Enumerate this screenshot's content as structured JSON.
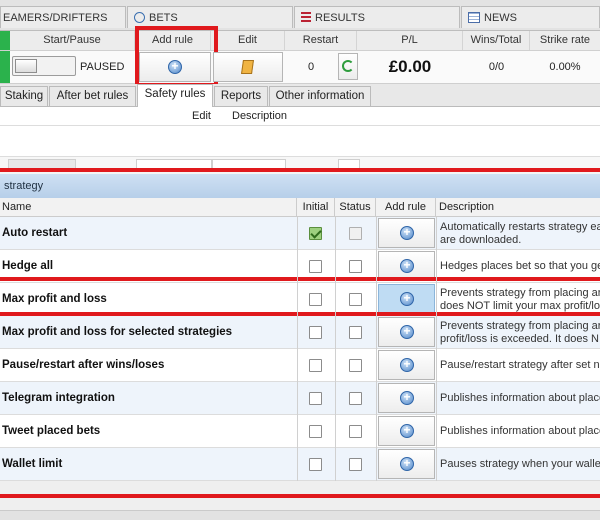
{
  "top_tabs": {
    "streamers": "EAMERS/DRIFTERS",
    "bets": "BETS",
    "results": "RESULTS",
    "news": "NEWS"
  },
  "header": {
    "start_pause": "Start/Pause",
    "add_rule": "Add rule",
    "edit": "Edit",
    "restart": "Restart",
    "pl": "P/L",
    "wins_total": "Wins/Total",
    "strike_rate": "Strike rate"
  },
  "values": {
    "status": "PAUSED",
    "restart_count": "0",
    "pl": "£0.00",
    "wins_total": "0/0",
    "strike_rate": "0.00%"
  },
  "inner_tabs": [
    "Staking",
    "After bet rules",
    "Safety rules",
    "Reports",
    "Other information"
  ],
  "active_inner_tab": "Safety rules",
  "sub_header": {
    "edit": "Edit",
    "description": "Description"
  },
  "strategy": {
    "title": "strategy",
    "columns": {
      "name": "Name",
      "initial": "Initial",
      "status": "Status",
      "add_rule": "Add rule",
      "description": "Description"
    },
    "rows": [
      {
        "name": "Auto restart",
        "initial": true,
        "desc1": "Automatically restarts strategy ea",
        "desc2": "are downloaded."
      },
      {
        "name": "Hedge all",
        "initial": false,
        "desc1": "Hedges places bet so that you ge",
        "desc2": ""
      },
      {
        "name": "Max profit and loss",
        "initial": false,
        "desc1": "Prevents strategy from placing ar",
        "desc2": "does NOT limit your max profit/los",
        "highlight": true
      },
      {
        "name": "Max profit and loss for selected strategies",
        "initial": false,
        "desc1": "Prevents strategy from placing ar",
        "desc2": "profit/loss is exceeded. It does N"
      },
      {
        "name": "Pause/restart after wins/loses",
        "initial": false,
        "desc1": "Pause/restart strategy after set n",
        "desc2": ""
      },
      {
        "name": "Telegram integration",
        "initial": false,
        "desc1": "Publishes information about place",
        "desc2": ""
      },
      {
        "name": "Tweet placed bets",
        "initial": false,
        "desc1": "Publishes information about place",
        "desc2": ""
      },
      {
        "name": "Wallet limit",
        "initial": false,
        "desc1": "Pauses strategy when your walle",
        "desc2": ""
      }
    ]
  },
  "colors": {
    "annotation_red": "#e0191d",
    "strategy_bar": "#c4d8ee",
    "accent_green": "#2bb24c"
  }
}
